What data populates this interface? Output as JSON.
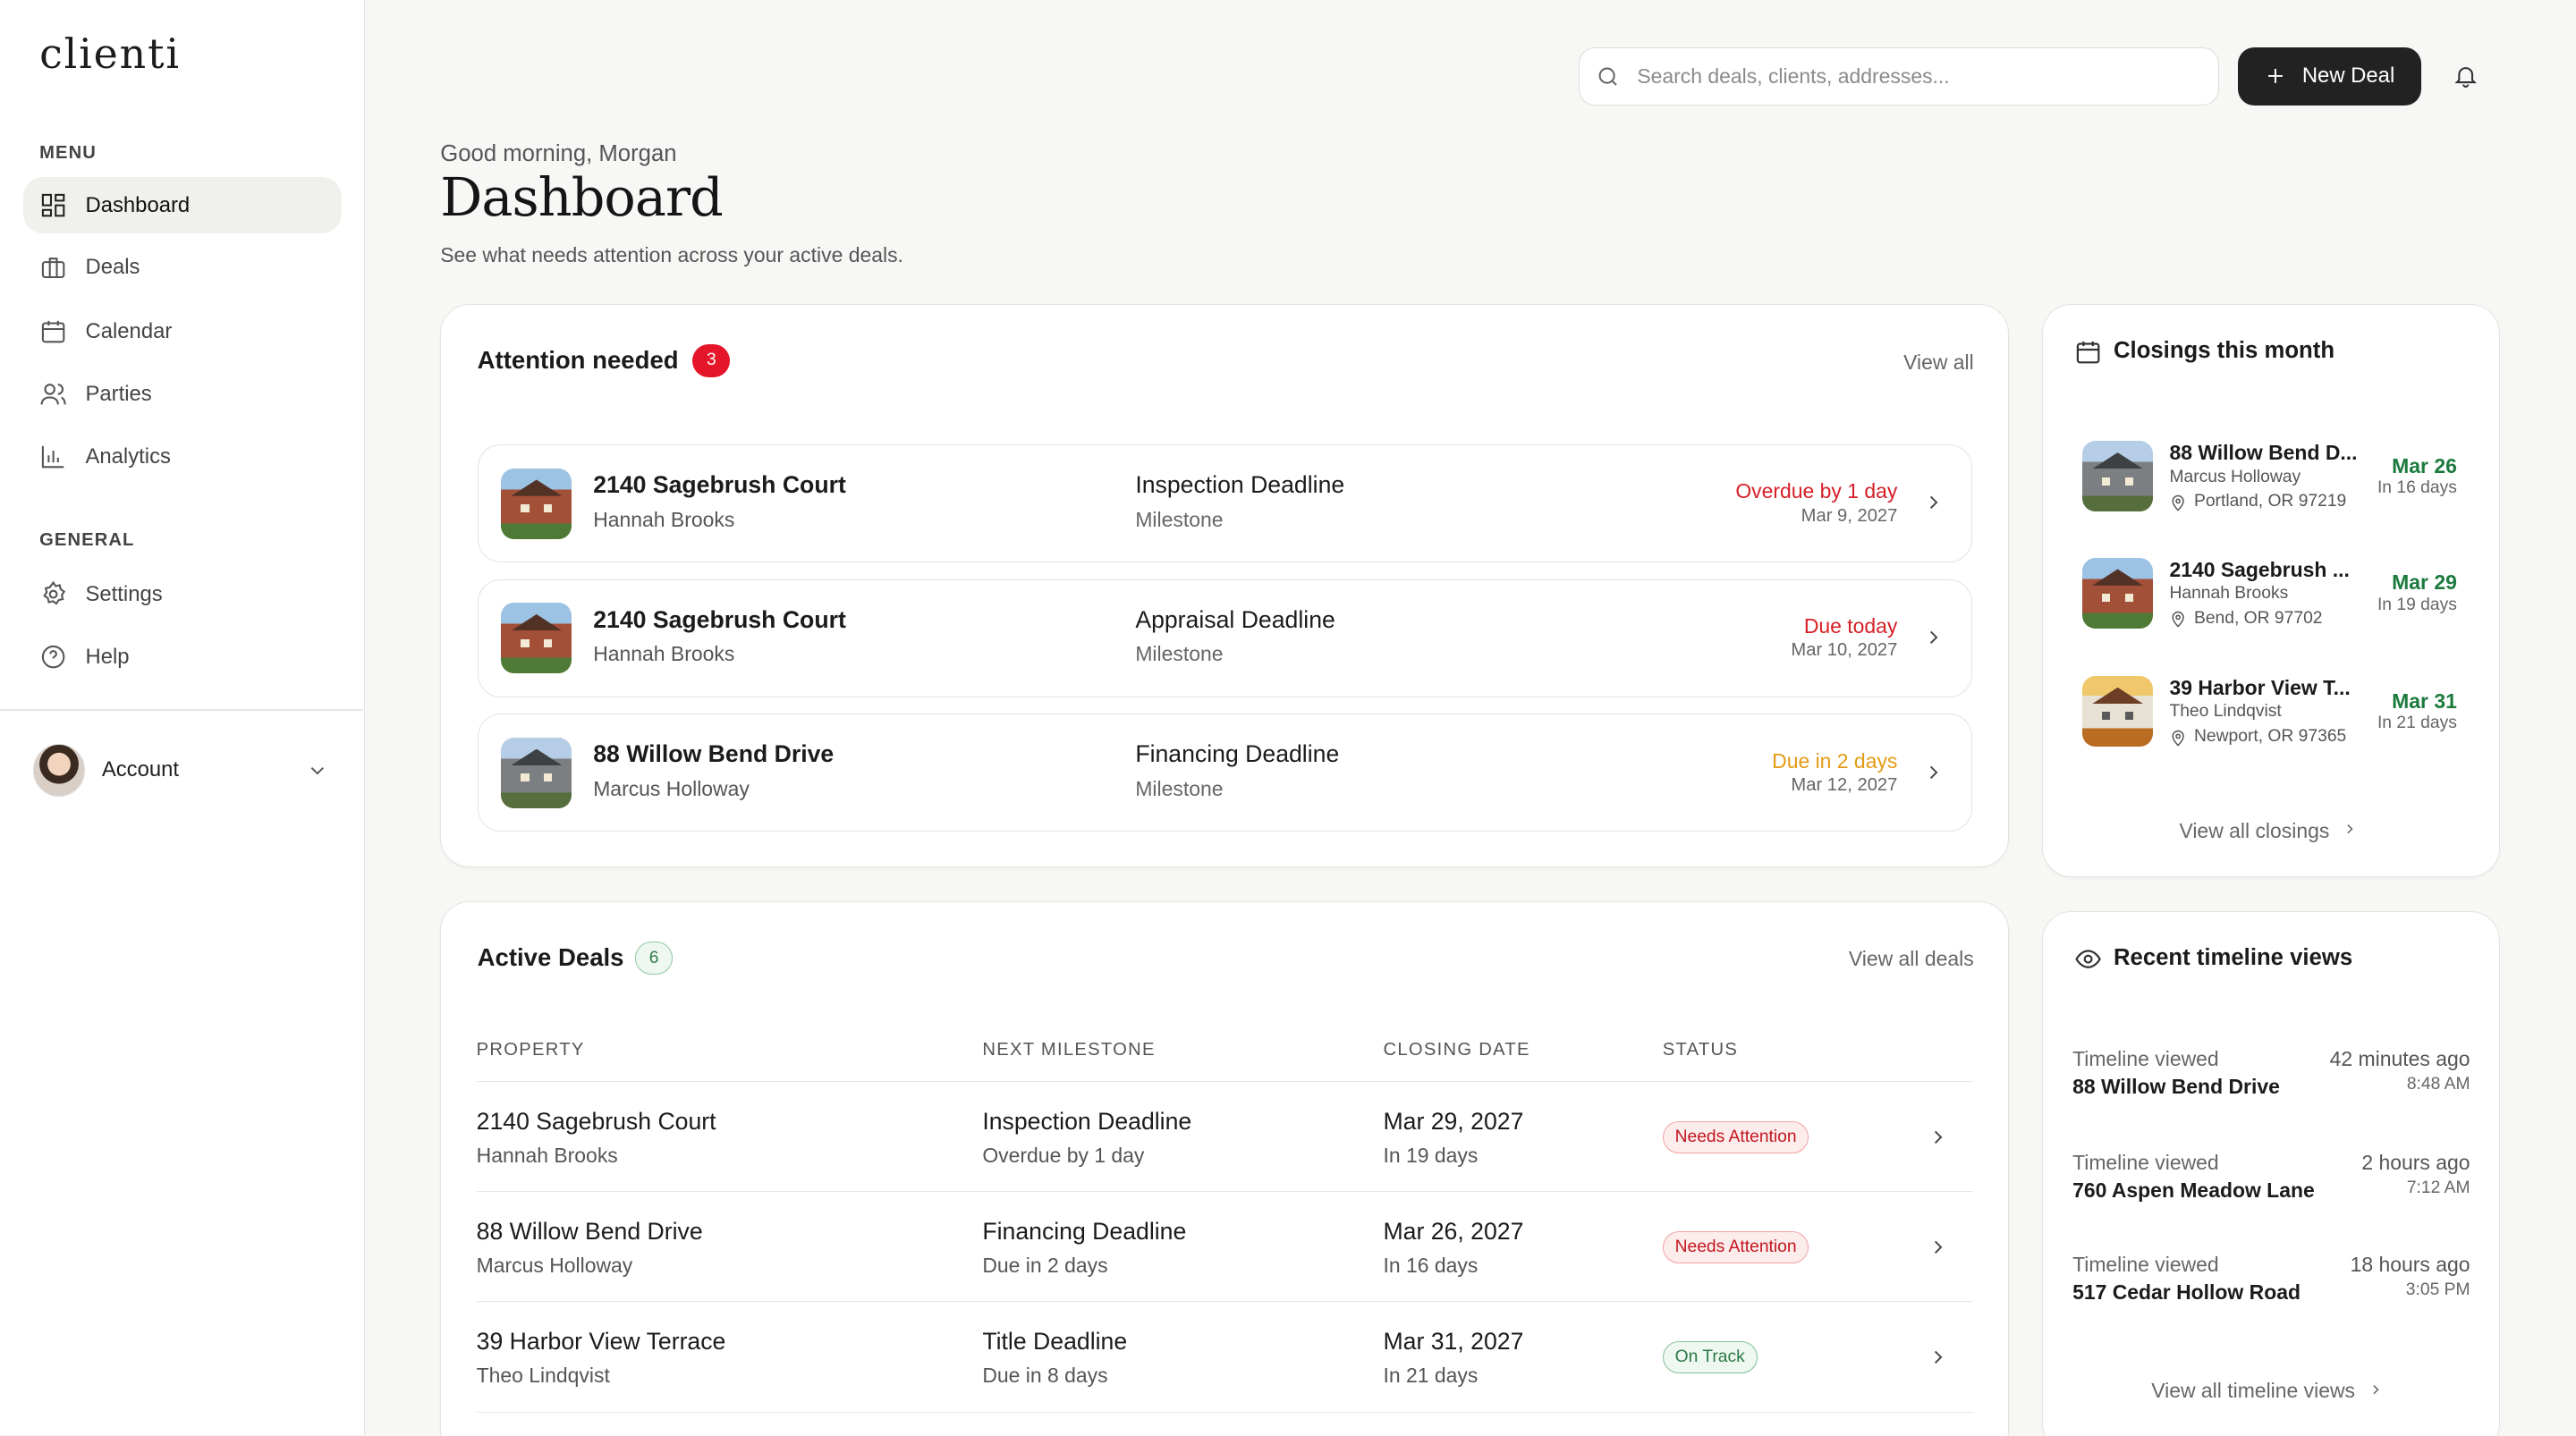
{
  "brand": {
    "logo": "clienti"
  },
  "sidebar": {
    "menu_label": "MENU",
    "general_label": "GENERAL",
    "menu_items": [
      {
        "label": "Dashboard",
        "icon": "grid-icon",
        "active": true
      },
      {
        "label": "Deals",
        "icon": "briefcase-icon"
      },
      {
        "label": "Calendar",
        "icon": "calendar-icon"
      },
      {
        "label": "Parties",
        "icon": "users-icon"
      },
      {
        "label": "Analytics",
        "icon": "bar-chart-icon"
      }
    ],
    "general_items": [
      {
        "label": "Settings",
        "icon": "gear-icon"
      },
      {
        "label": "Help",
        "icon": "help-circle-icon"
      }
    ],
    "account_label": "Account"
  },
  "topbar": {
    "search_placeholder": "Search deals, clients, addresses...",
    "new_deal_label": "New Deal"
  },
  "header": {
    "greeting": "Good morning, Morgan",
    "title": "Dashboard",
    "subtitle": "See what needs attention across your active deals."
  },
  "attention": {
    "title": "Attention needed",
    "count": "3",
    "view_all": "View all",
    "items": [
      {
        "property": "2140 Sagebrush Court",
        "client": "Hannah Brooks",
        "milestone": "Inspection Deadline",
        "type": "Milestone",
        "status": "Overdue by 1 day",
        "status_color": "#d61f26",
        "date": "Mar 9, 2027",
        "thumb": "brick"
      },
      {
        "property": "2140 Sagebrush Court",
        "client": "Hannah Brooks",
        "milestone": "Appraisal Deadline",
        "type": "Milestone",
        "status": "Due today",
        "status_color": "#d61f26",
        "date": "Mar 10, 2027",
        "thumb": "brick"
      },
      {
        "property": "88 Willow Bend Drive",
        "client": "Marcus Holloway",
        "milestone": "Financing Deadline",
        "type": "Milestone",
        "status": "Due in 2 days",
        "status_color": "#e59a14",
        "date": "Mar 12, 2027",
        "thumb": "gray"
      }
    ]
  },
  "active_deals": {
    "title": "Active Deals",
    "count": "6",
    "view_all": "View all deals",
    "columns": [
      "PROPERTY",
      "NEXT MILESTONE",
      "CLOSING DATE",
      "STATUS"
    ],
    "rows": [
      {
        "property": "2140 Sagebrush Court",
        "client": "Hannah Brooks",
        "milestone": "Inspection Deadline",
        "milestone_sub": "Overdue by 1 day",
        "closing": "Mar 29, 2027",
        "closing_sub": "In 19 days",
        "status": "Needs Attention",
        "status_kind": "attn"
      },
      {
        "property": "88 Willow Bend Drive",
        "client": "Marcus Holloway",
        "milestone": "Financing Deadline",
        "milestone_sub": "Due in 2 days",
        "closing": "Mar 26, 2027",
        "closing_sub": "In 16 days",
        "status": "Needs Attention",
        "status_kind": "attn"
      },
      {
        "property": "39 Harbor View Terrace",
        "client": "Theo Lindqvist",
        "milestone": "Title Deadline",
        "milestone_sub": "Due in 8 days",
        "closing": "Mar 31, 2027",
        "closing_sub": "In 21 days",
        "status": "On Track",
        "status_kind": "track"
      }
    ]
  },
  "closings": {
    "title": "Closings this month",
    "view_all": "View all closings",
    "items": [
      {
        "name": "88 Willow Bend D...",
        "client": "Marcus Holloway",
        "city": "Portland, OR 97219",
        "date": "Mar 26",
        "in": "In 16 days",
        "thumb": "gray"
      },
      {
        "name": "2140 Sagebrush ...",
        "client": "Hannah Brooks",
        "city": "Bend, OR 97702",
        "date": "Mar 29",
        "in": "In 19 days",
        "thumb": "brick"
      },
      {
        "name": "39 Harbor View T...",
        "client": "Theo Lindqvist",
        "city": "Newport, OR 97365",
        "date": "Mar 31",
        "in": "In 21 days",
        "thumb": "fall"
      }
    ]
  },
  "timeline": {
    "title": "Recent timeline views",
    "view_all": "View all timeline views",
    "items": [
      {
        "label": "Timeline viewed",
        "address": "88 Willow Bend Drive",
        "ago": "42 minutes ago",
        "time": "8:48 AM"
      },
      {
        "label": "Timeline viewed",
        "address": "760 Aspen Meadow Lane",
        "ago": "2 hours ago",
        "time": "7:12 AM"
      },
      {
        "label": "Timeline viewed",
        "address": "517 Cedar Hollow Road",
        "ago": "18 hours ago",
        "time": "3:05 PM"
      }
    ]
  }
}
